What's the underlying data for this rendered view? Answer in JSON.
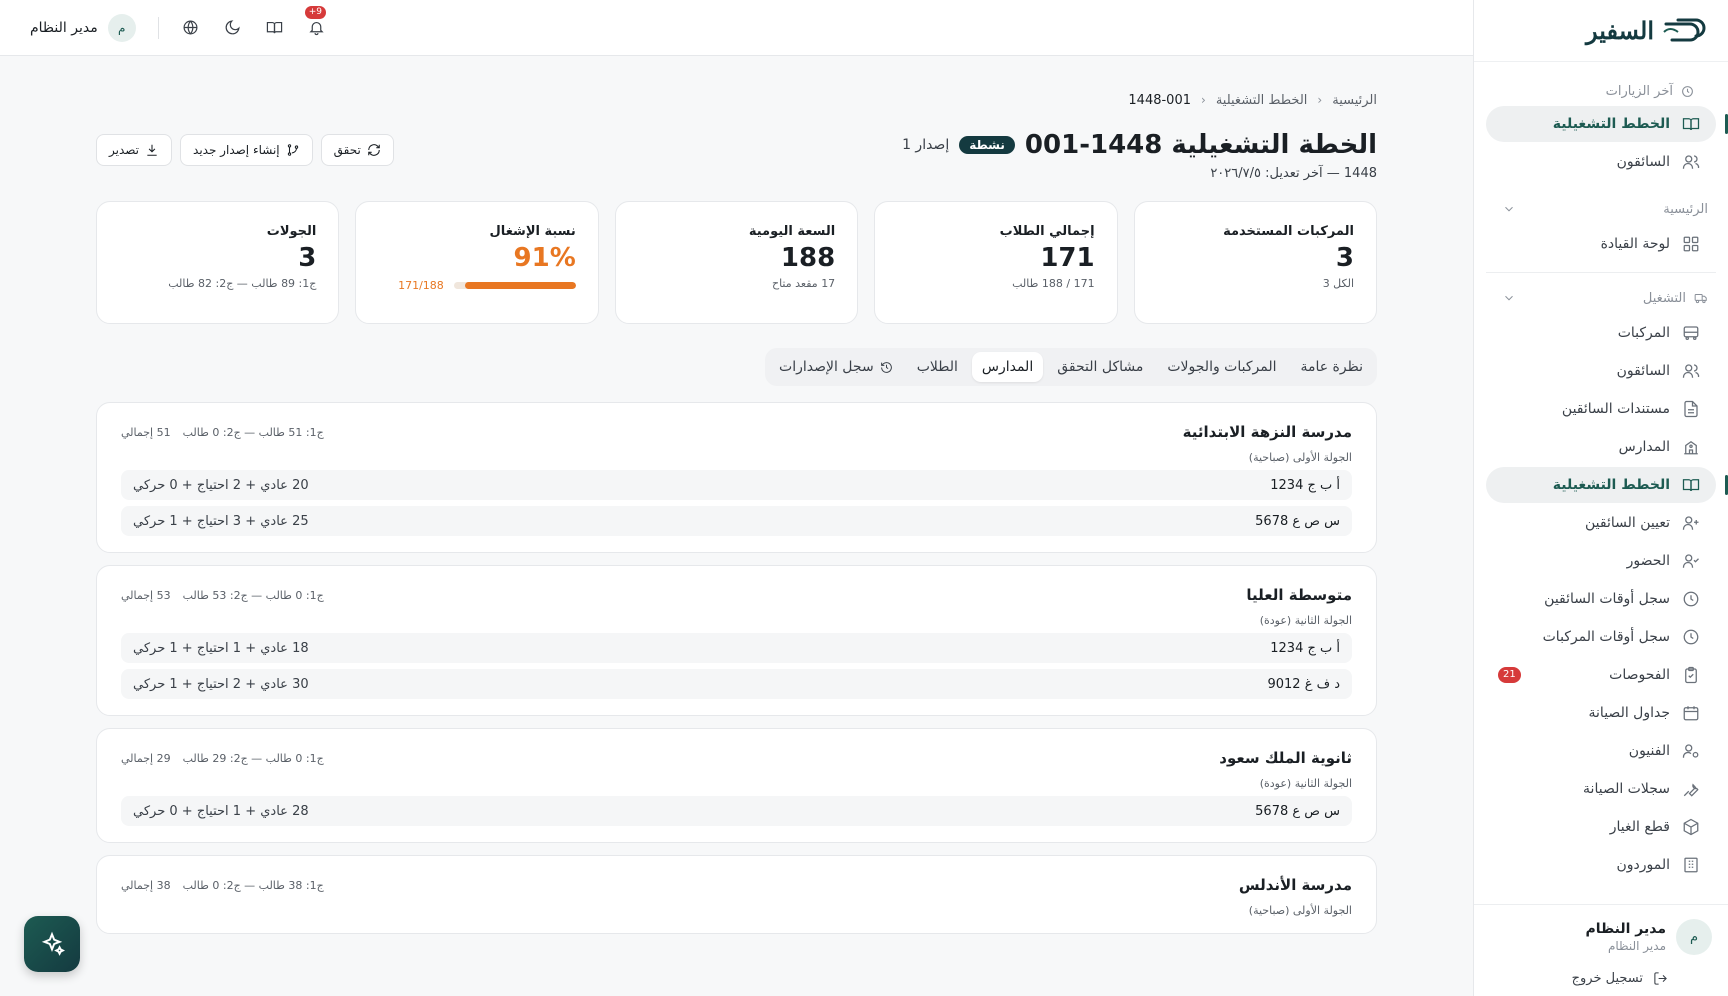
{
  "brand": {
    "name": "السفير",
    "accent": "#1d5b52"
  },
  "topbar": {
    "user_name": "مدير النظام",
    "user_initial": "م",
    "notif_count": "+9",
    "icons": [
      "globe-icon",
      "moon-icon",
      "book-icon",
      "bell-icon"
    ]
  },
  "sidebar": {
    "recent_label": "آخر الزيارات",
    "recent_items": [
      {
        "label": "الخطط التشغيلية",
        "icon": "book-open-icon",
        "active": true
      },
      {
        "label": "السائقون",
        "icon": "users-icon"
      }
    ],
    "group_main": {
      "label": "الرئيسية",
      "items": [
        {
          "label": "لوحة القيادة",
          "icon": "dashboard-icon"
        }
      ]
    },
    "group_ops": {
      "label": "التشغيل",
      "items": [
        {
          "label": "المركبات",
          "icon": "bus-icon"
        },
        {
          "label": "السائقون",
          "icon": "users-icon"
        },
        {
          "label": "مستندات السائقين",
          "icon": "file-icon"
        },
        {
          "label": "المدارس",
          "icon": "school-icon"
        },
        {
          "label": "الخطط التشغيلية",
          "icon": "book-open-icon",
          "active": true
        },
        {
          "label": "تعيين السائقين",
          "icon": "user-plus-icon"
        },
        {
          "label": "الحضور",
          "icon": "user-check-icon"
        },
        {
          "label": "سجل أوقات السائقين",
          "icon": "clock-icon"
        },
        {
          "label": "سجل أوقات المركبات",
          "icon": "clock-icon"
        },
        {
          "label": "الفحوصات",
          "icon": "clipboard-icon",
          "badge": "21"
        },
        {
          "label": "جداول الصيانة",
          "icon": "calendar-icon"
        },
        {
          "label": "الفنيون",
          "icon": "user-cog-icon"
        },
        {
          "label": "سجلات الصيانة",
          "icon": "wrench-icon"
        },
        {
          "label": "قطع الغيار",
          "icon": "package-icon"
        },
        {
          "label": "الموردون",
          "icon": "building-icon"
        }
      ]
    },
    "footer": {
      "name": "مدير النظام",
      "role": "مدير النظام",
      "initial": "م",
      "logout": "تسجيل خروج"
    }
  },
  "breadcrumb": {
    "home": "الرئيسية",
    "section": "الخطط التشغيلية",
    "current": "1448-001"
  },
  "header": {
    "title": "الخطة التشغيلية 1448-001",
    "status": "نشطة",
    "version": "إصدار 1",
    "subtitle": "1448 — آخر تعديل: ٢٠٢٦/٧/٥"
  },
  "actions": {
    "verify": "تحقق",
    "new_version": "إنشاء إصدار جديد",
    "export": "تصدير"
  },
  "stats": [
    {
      "label": "المركبات المستخدمة",
      "value": "3",
      "sub": "الكل 3"
    },
    {
      "label": "إجمالي الطلاب",
      "value": "171",
      "sub": "171 / 188 طالب"
    },
    {
      "label": "السعة اليومية",
      "value": "188",
      "sub": "17 مقعد متاح"
    },
    {
      "label": "نسبة الإشغال",
      "value": "91%",
      "progress": 0.91,
      "progress_text": "171/188"
    },
    {
      "label": "الجولات",
      "value": "3",
      "sub": "ج1: 89 طالب — ج2: 82 طالب"
    }
  ],
  "tabs": [
    {
      "label": "نظرة عامة"
    },
    {
      "label": "المركبات والجولات"
    },
    {
      "label": "مشاكل التحقق"
    },
    {
      "label": "المدارس",
      "active": true
    },
    {
      "label": "الطلاب"
    },
    {
      "label": "سجل الإصدارات"
    }
  ],
  "schools": [
    {
      "name": "مدرسة النزهة الابتدائية",
      "meta_rounds": "ج1: 51 طالب — ج2: 0 طالب",
      "meta_total": "51 إجمالي",
      "round": "الجولة الأولى (صباحية)",
      "rows": [
        {
          "plate": "أ ب ج 1234",
          "cap": "20 عادي + 2 احتياج + 0 حركي"
        },
        {
          "plate": "س ص ع 5678",
          "cap": "25 عادي + 3 احتياج + 1 حركي"
        }
      ]
    },
    {
      "name": "متوسطة العليا",
      "meta_rounds": "ج1: 0 طالب — ج2: 53 طالب",
      "meta_total": "53 إجمالي",
      "round": "الجولة الثانية (عودة)",
      "rows": [
        {
          "plate": "أ ب ج 1234",
          "cap": "18 عادي + 1 احتياج + 1 حركي"
        },
        {
          "plate": "د ف غ 9012",
          "cap": "30 عادي + 2 احتياج + 1 حركي"
        }
      ]
    },
    {
      "name": "ثانوية الملك سعود",
      "meta_rounds": "ج1: 0 طالب — ج2: 29 طالب",
      "meta_total": "29 إجمالي",
      "round": "الجولة الثانية (عودة)",
      "rows": [
        {
          "plate": "س ص ع 5678",
          "cap": "28 عادي + 1 احتياج + 0 حركي"
        }
      ]
    },
    {
      "name": "مدرسة الأندلس",
      "meta_rounds": "ج1: 38 طالب — ج2: 0 طالب",
      "meta_total": "38 إجمالي",
      "round": "الجولة الأولى (صباحية)",
      "rows": []
    }
  ]
}
